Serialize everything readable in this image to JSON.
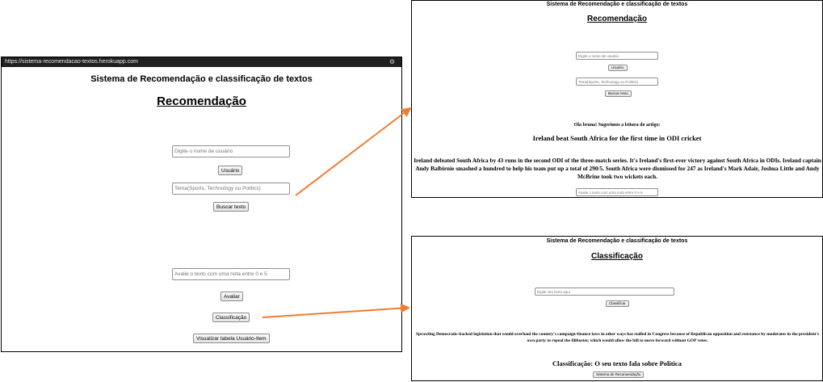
{
  "main": {
    "url": "https://sistema-recomendacao-textos.herokuapp.com",
    "app_title": "Sistema de Recomendação e classificação de textos",
    "heading": "Recomendação",
    "username_placeholder": "Digite o nome de usuário",
    "user_button": "Usuário",
    "topic_placeholder": "Tema(Sports, Technology ou Politics)",
    "search_button": "Buscar texto",
    "rating_placeholder": "Avalie o texto com uma nota entre 0 e 5",
    "rate_button": "Avaliar",
    "classify_button": "Classificação",
    "table_button": "Visualizar tabela Usuário-Item"
  },
  "recommendation": {
    "app_title": "Sistema de Recomendação e classificação de textos",
    "heading": "Recomendação",
    "username_placeholder": "Digite o nome de usuário",
    "user_button": "Usuário",
    "topic_placeholder": "Tema(Sports, Technology ou Politics)",
    "search_button": "Buscar texto",
    "greeting": "Ola bruna! Sugerimos a leitura do artigo:",
    "article_title": "Ireland beat South Africa for the first time in ODI cricket",
    "article_body": "Ireland defeated South Africa by 43 runs in the second ODI of the three-match series. It's Ireland's first-ever victory against South Africa in ODIs. Ireland captain Andy Balbirnie smashed a hundred to help his team put up a total of 290/5. South Africa were dismissed for 247 as Ireland's Mark Adair, Joshua Little and Andy McBrine took two wickets each.",
    "rating_placeholder": "Avalie o texto com uma nota entre 0 e 5"
  },
  "classification": {
    "app_title": "Sistema de Recomendação e classificação de textos",
    "heading": "Classificação",
    "text_placeholder": "Digite seu texto aqui",
    "classify_button": "Classificar",
    "input_text": "Sprawling Democratic-backed legislation that would overhaul the country's campaign-finance laws in other ways has stalled in Congress because of Republican opposition and resistance by moderates in the president's own party to repeal the filibuster, which would allow the bill to move forward without GOP votes.",
    "result": "Classificação: O seu texto fala sobre Politica",
    "back_button": "Sistema de Recomendação"
  },
  "colors": {
    "arrow": "#ed7d31",
    "urlbar": "#1f1f1f"
  }
}
